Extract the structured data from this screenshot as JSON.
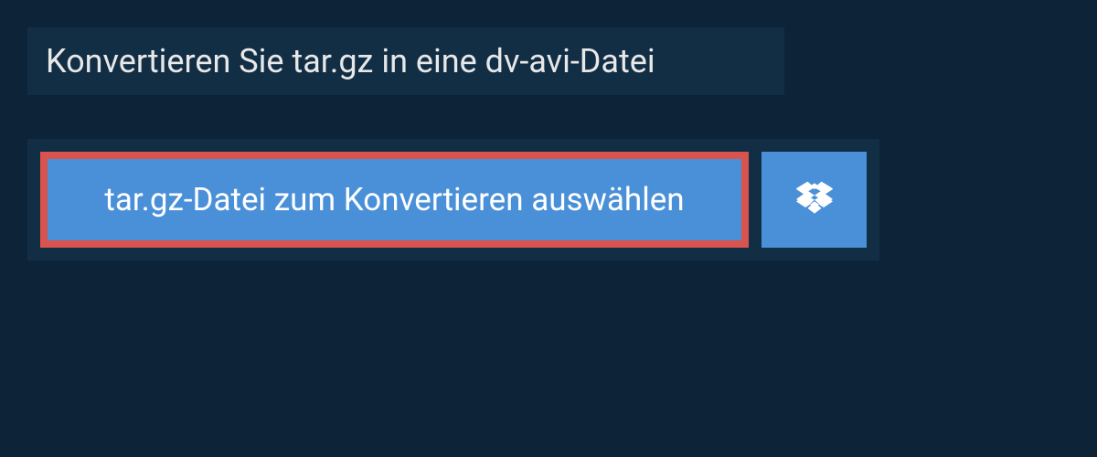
{
  "header": {
    "title": "Konvertieren Sie tar.gz in eine dv-avi-Datei"
  },
  "upload": {
    "select_file_label": "tar.gz-Datei zum Konvertieren auswählen",
    "dropbox_icon": "dropbox-icon"
  }
}
